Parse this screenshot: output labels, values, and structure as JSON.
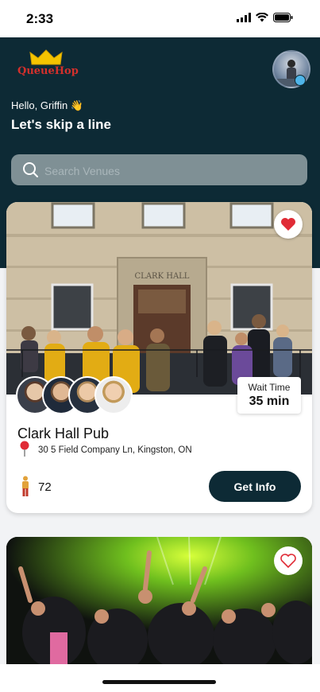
{
  "status_bar": {
    "time": "2:33"
  },
  "header": {
    "logo_text": "QueueHop",
    "greeting": "Hello, Griffin 👋",
    "tagline": "Let's skip a line"
  },
  "search": {
    "placeholder": "Search Venues"
  },
  "venues": [
    {
      "name": "Clark Hall Pub",
      "address": "30 5 Field Company Ln, Kingston, ON",
      "wait_label": "Wait Time",
      "wait_value": "35 min",
      "people_count": "72",
      "cta_label": "Get Info",
      "favorited": true,
      "photo_sign": "CLARK HALL"
    },
    {
      "favorited": false
    }
  ],
  "colors": {
    "brand_dark": "#0d2a35",
    "heart_red": "#e02b36",
    "logo_red": "#d3302c",
    "crown_gold": "#f5c400"
  }
}
